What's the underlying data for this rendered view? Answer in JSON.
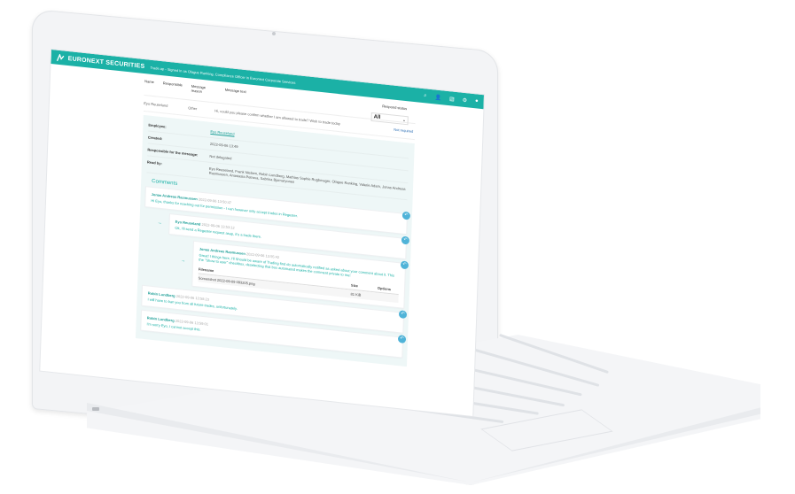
{
  "app": {
    "brand": "EURONEXT SECURITIES",
    "subtitle": "Trade.ap - Signed in as Olague Ranking, Compliance Officer in Euronext Corporate Services",
    "toolbar_icons": [
      "search-icon",
      "user-icon",
      "report-icon",
      "settings-icon",
      "notifications-icon"
    ]
  },
  "filters": {
    "name": "Name",
    "responsible": "Responsible",
    "message_reason": "Message reason",
    "message_text": "Message text",
    "respond_status": "Respond status",
    "status_value": "All"
  },
  "message": {
    "from": "Eyo Reuseland",
    "type": "Other",
    "text": "Hi, could you please confirm whether I am allowed to trade? Wish to trade today",
    "badge": "Not required"
  },
  "detail": {
    "employee_label": "Employee:",
    "employee_value": "Eyo Reuseland",
    "created_label": "Created:",
    "created_value": "2022-09-06 13:49",
    "responsible_label": "Responsible for the message:",
    "responsible_value": "Not delegated",
    "readby_label": "Read by:",
    "readby_value": "Eyo Reuseland, Frank Nielsen, Robin Lundberg, Mathias Sophie Rugbmager, Olague Ranking, Valerie Adam, Jonas Andreas Rasmussen, Anastasia Petrova, Sabrina Bjornaryonen"
  },
  "comments": {
    "title": "Comments",
    "items": [
      {
        "name": "Jonas Andreas Rasmussen",
        "date": "2022-09-06 13:50:47",
        "text": "Hi Eyo, thanks for reaching out for permission - I can however only accept trades in Regester."
      },
      {
        "name": "Eyo Reuseland",
        "date": "2022-09-06 13:53:12",
        "text": "Ok, I'll send a Regester request asap, it's a trade there."
      },
      {
        "name": "Jonas Andreas Rasmussen",
        "date": "2022-09-06 13:55:42",
        "text": "Great! I things here, I'll Should be aware of Trading find do automatically notified as asked about your comment about it. This the \"Show to user\" checkbox, deselecting that box automated makes the comment private to me!"
      },
      {
        "name": "Robin Lundberg",
        "date": "2022-09-06 13:58:23",
        "text": "I will have to ban you from all future trades, unfortunately."
      },
      {
        "name": "Robin Lundberg",
        "date": "2022-09-06 13:59:01",
        "text": "I'm sorry Eyo, I cannot accept this."
      }
    ],
    "file_table": {
      "headers": [
        "Filename",
        "Size",
        "Options"
      ],
      "rows": [
        {
          "filename": "Screenshot 2022-09-09 093205.png",
          "size": "81 KiB"
        }
      ]
    }
  }
}
